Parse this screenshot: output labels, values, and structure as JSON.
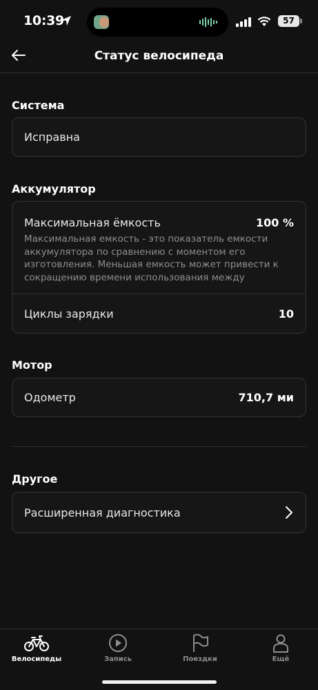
{
  "status_bar": {
    "time": "10:39",
    "battery": "57"
  },
  "header": {
    "title": "Статус велосипеда"
  },
  "system": {
    "title": "Система",
    "status": "Исправна"
  },
  "battery_section": {
    "title": "Аккумулятор",
    "max_capacity_label": "Максимальная ёмкость",
    "max_capacity_value": "100 %",
    "description": "Максимальная емкость - это показатель емкости аккумулятора по сравнению с моментом его изготовления. Меньшая емкость может привести к сокращению времени использования между зарядками.",
    "cycles_label": "Циклы зарядки",
    "cycles_value": "10"
  },
  "motor": {
    "title": "Мотор",
    "odometer_label": "Одометр",
    "odometer_value": "710,7 ми"
  },
  "other": {
    "title": "Другое",
    "diagnostics_label": "Расширенная диагностика"
  },
  "tabs": [
    {
      "label": "Велосипеды",
      "icon": "bike-icon"
    },
    {
      "label": "Запись",
      "icon": "play-icon"
    },
    {
      "label": "Поездки",
      "icon": "flag-icon"
    },
    {
      "label": "Ещё",
      "icon": "person-icon"
    }
  ]
}
